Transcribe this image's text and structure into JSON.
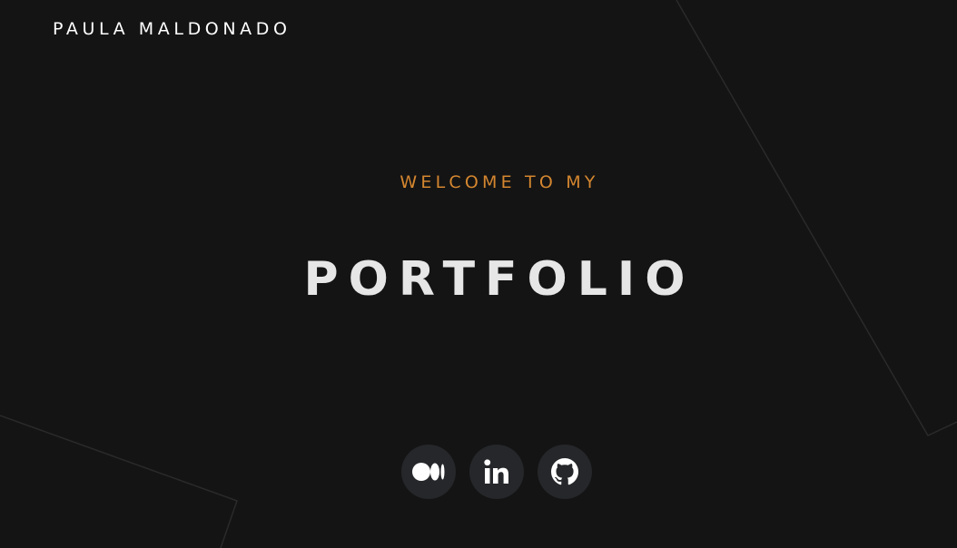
{
  "header": {
    "brand": "PAULA MALDONADO"
  },
  "hero": {
    "eyebrow": "WELCOME TO MY",
    "title": "PORTFOLIO"
  },
  "socials": [
    {
      "icon": "medium-icon"
    },
    {
      "icon": "linkedin-icon"
    },
    {
      "icon": "github-icon"
    }
  ],
  "colors": {
    "background": "#141414",
    "accent": "#d4862f",
    "title": "#e6e6e6",
    "icon_bg": "#25272a"
  }
}
